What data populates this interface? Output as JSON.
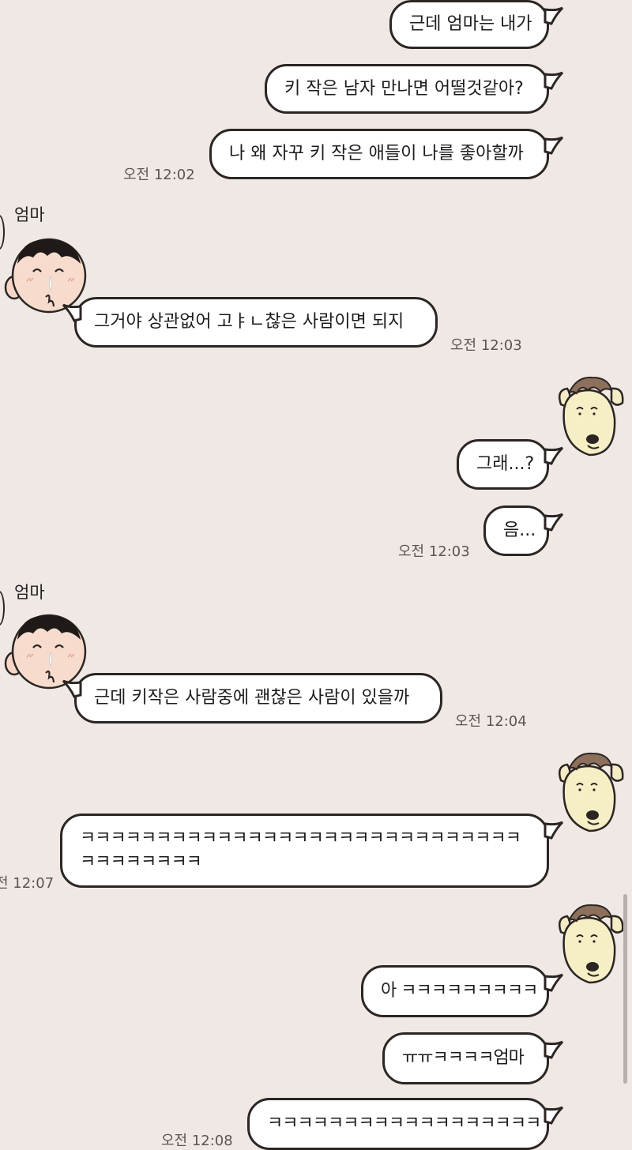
{
  "contact_name": "엄마",
  "messages": [
    {
      "id": "m1",
      "from": "me",
      "text": "근데 엄마는 내가"
    },
    {
      "id": "m2",
      "from": "me",
      "text": "키 작은 남자 만나면 어떨것같아?"
    },
    {
      "id": "m3",
      "from": "me",
      "text": "나 왜 자꾸 키 작은 애들이 나를 좋아할까",
      "time": "오전 12:02"
    },
    {
      "id": "m4",
      "from": "mom",
      "text": "그거야 상관없어 고ㅑㄴ찮은 사람이면 되지",
      "time": "오전 12:03"
    },
    {
      "id": "m5",
      "from": "me",
      "text": "그래...?"
    },
    {
      "id": "m6",
      "from": "me",
      "text": "음...",
      "time": "오전 12:03"
    },
    {
      "id": "m7",
      "from": "mom",
      "text": "근데 키작은 사람중에 괜찮은 사람이 있을까",
      "time": "오전 12:04"
    },
    {
      "id": "m8",
      "from": "me",
      "text": "ㅋㅋㅋㅋㅋㅋㅋㅋㅋㅋㅋㅋㅋㅋㅋㅋㅋㅋㅋㅋㅋㅋㅋㅋㅋㅋㅋㅋㅋㅋㅋㅋㅋㅋㅋㅋㅋ",
      "time": "전 12:07"
    },
    {
      "id": "m9",
      "from": "me",
      "text": "아 ㅋㅋㅋㅋㅋㅋㅋㅋㅋ"
    },
    {
      "id": "m10",
      "from": "me",
      "text": "ㅠㅠㅋㅋㅋㅋ엄마"
    },
    {
      "id": "m11",
      "from": "me",
      "text": "ㅋㅋㅋㅋㅋㅋㅋㅋㅋㅋㅋㅋㅋㅋㅋㅋㅋㅋ",
      "time": "오전 12:08"
    }
  ],
  "icons": {
    "mom_avatar": "boy-character-icon",
    "my_avatar": "dog-character-icon"
  },
  "colors": {
    "background": "#efe8e4",
    "bubble": "#ffffff",
    "bubble_border": "#2b2523"
  }
}
